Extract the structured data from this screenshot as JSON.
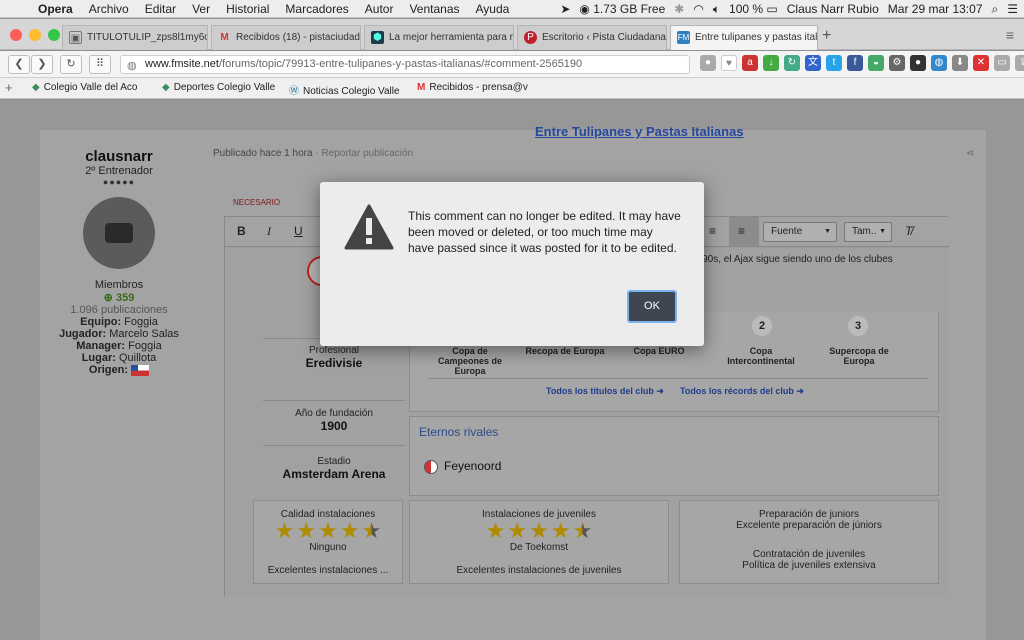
{
  "menubar": {
    "app": "Opera",
    "items": [
      "Archivo",
      "Editar",
      "Ver",
      "Historial",
      "Marcadores",
      "Autor",
      "Ventanas",
      "Ayuda"
    ],
    "memory": "1.73 GB Free",
    "battery": "100 %",
    "user": "Claus Narr Rubio",
    "datetime": "Mar 29 mar  13:07"
  },
  "tabs": [
    {
      "label": "TITULOTULIP_zps8l1my6ob.p",
      "icon": "image-tab-icon"
    },
    {
      "label": "Recibidos (18) - pistaciudad",
      "icon": "gmail-tab-icon"
    },
    {
      "label": "La mejor herramienta para re",
      "icon": "hex-tab-icon"
    },
    {
      "label": "Escritorio ‹ Pista Ciudadana",
      "icon": "wordpress-red-tab-icon"
    },
    {
      "label": "Entre tulipanes y pastas italia",
      "icon": "fm-tab-icon"
    }
  ],
  "address": {
    "domain": "www.fmsite.net",
    "path": "/forums/topic/79913-entre-tulipanes-y-pastas-italianas/#comment-2565190"
  },
  "bookmarks": [
    {
      "label": "Colegio Valle del Aco"
    },
    {
      "label": "Deportes Colegio Valle"
    },
    {
      "label": "Noticias Colegio Valle"
    },
    {
      "label": "Recibidos - prensa@v"
    }
  ],
  "page": {
    "top_link": "Entre Tulipanes y Pastas Italianas",
    "author": {
      "name": "clausnarr",
      "rank": "2º Entrenador",
      "rank_dots": "●●●●●",
      "group": "Miembros",
      "reputation": "359",
      "posts": "1.096 publicaciones",
      "equipo_label": "Equipo:",
      "equipo": "Foggia",
      "jugador_label": "Jugador:",
      "jugador": "Marcelo Salas",
      "manager_label": "Manager:",
      "manager": "Foggia",
      "lugar_label": "Lugar:",
      "lugar": "Quillota",
      "origen_label": "Origen:"
    },
    "posted": "Publicado hace 1 hora",
    "report": "· Reportar publicación",
    "necesario": "NECESARIO",
    "editor": {
      "font_label": "Fuente",
      "size_label": "Tam..",
      "history_text": "1990s, el Ajax sigue siendo uno de los clubes"
    },
    "club": {
      "profesional_label": "Profesional",
      "league": "Eredivisie",
      "founded_label": "Año de fundación",
      "founded": "1900",
      "stadium_label": "Estadio",
      "stadium": "Amsterdam Arena",
      "trophies": [
        "Copa de Campeones de Europa",
        "Recopa de Europa",
        "Copa EURO",
        "Copa Intercontinental",
        "Supercopa de Europa"
      ],
      "trophy_counts": [
        "",
        "",
        "",
        "2",
        "3"
      ],
      "all_titles": "Todos los títulos del club ➜",
      "all_records": "Todos los récords del club ➜",
      "rivals_title": "Eternos rivales",
      "rival": "Feyenoord"
    },
    "facilities": {
      "calidad_label": "Calidad instalaciones",
      "calidad_stars": 4.5,
      "calidad_name": "Ninguno",
      "calidad_desc": "Excelentes instalaciones ...",
      "juveniles_label": "Instalaciones de juveniles",
      "juveniles_stars": 4.5,
      "juveniles_name": "De Toekomst",
      "juveniles_desc": "Excelentes instalaciones de juveniles",
      "prep_label": "Preparación de juniors",
      "prep_value": "Excelente preparación de júniors",
      "contr_label": "Contratación de juveniles",
      "contr_value": "Política de juveniles extensiva"
    }
  },
  "modal": {
    "message": "This comment can no longer be edited. It may have been moved or deleted, or too much time may have passed since it was posted for it to be edited.",
    "ok_label": "OK"
  }
}
